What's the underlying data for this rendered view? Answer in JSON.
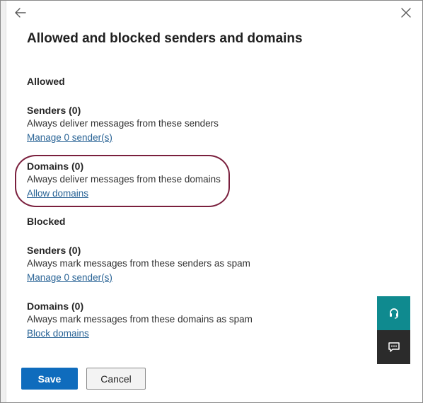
{
  "dialog": {
    "title": "Allowed and blocked senders and domains"
  },
  "allowed": {
    "heading": "Allowed",
    "senders": {
      "title": "Senders (0)",
      "description": "Always deliver messages from these senders",
      "link": "Manage 0 sender(s)"
    },
    "domains": {
      "title": "Domains (0)",
      "description": "Always deliver messages from these domains",
      "link": "Allow domains"
    }
  },
  "blocked": {
    "heading": "Blocked",
    "senders": {
      "title": "Senders (0)",
      "description": "Always mark messages from these senders as spam",
      "link": "Manage 0 sender(s)"
    },
    "domains": {
      "title": "Domains (0)",
      "description": "Always mark messages from these domains as spam",
      "link": "Block domains"
    }
  },
  "footer": {
    "save_label": "Save",
    "cancel_label": "Cancel"
  },
  "icons": {
    "back": "arrow-left-icon",
    "close": "close-icon",
    "help": "headset-icon",
    "feedback": "chat-feedback-icon"
  },
  "colors": {
    "primary": "#0f6cbd",
    "link": "#2a6496",
    "highlight_ring": "#7a1f3d",
    "help_button": "#0f8a8f",
    "feedback_button": "#2b2b2b"
  }
}
